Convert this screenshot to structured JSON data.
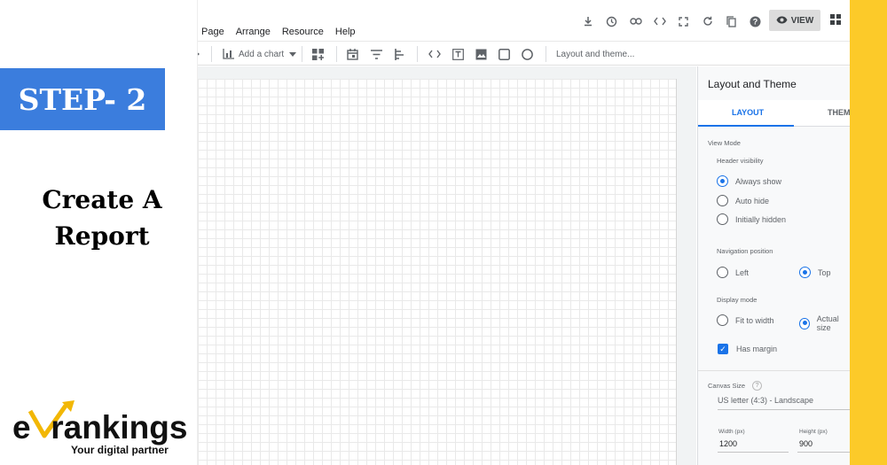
{
  "promo": {
    "step_label": "STEP- 2",
    "heading_line1": "Create A",
    "heading_line2": "Report",
    "logo_e": "e",
    "logo_v": "V",
    "logo_rest": "rankings",
    "logo_tm": "TM",
    "logo_tagline": "Your digital partner"
  },
  "colors": {
    "badge": "#3b7ddd",
    "stripe": "#fcca29",
    "accent": "#1a73e8",
    "logo_accent": "#f2b705"
  },
  "menubar": {
    "items": [
      "Page",
      "Arrange",
      "Resource",
      "Help"
    ],
    "view_label": "VIEW"
  },
  "top_icons": [
    "download-icon",
    "schedule-icon",
    "link-icon",
    "embed-icon",
    "fullscreen-icon",
    "refresh-icon",
    "copy-icon",
    "help-icon"
  ],
  "toolbar": {
    "add_chart_label": "Add a chart",
    "layout_theme_label": "Layout and theme..."
  },
  "panel": {
    "title": "Layout and Theme",
    "tab_layout": "LAYOUT",
    "tab_theme": "THEME",
    "view_mode_label": "View Mode",
    "header_visibility_label": "Header visibility",
    "header_options": [
      "Always show",
      "Auto hide",
      "Initially hidden"
    ],
    "header_selected": "Always show",
    "navigation_position_label": "Navigation position",
    "nav_left": "Left",
    "nav_top": "Top",
    "nav_selected": "Top",
    "display_mode_label": "Display mode",
    "display_fit": "Fit to width",
    "display_actual": "Actual size",
    "display_selected": "Actual size",
    "has_margin_label": "Has margin",
    "has_margin_checked": true,
    "canvas_size_label": "Canvas Size",
    "canvas_size_value": "US letter (4:3) - Landscape",
    "width_label": "Width (px)",
    "width_value": "1200",
    "height_label": "Height (px)",
    "height_value": "900"
  }
}
